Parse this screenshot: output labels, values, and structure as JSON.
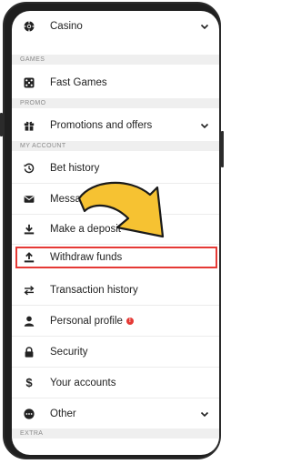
{
  "menu": {
    "casino": "Casino",
    "sections": {
      "games": "GAMES",
      "promo": "PROMO",
      "my_account": "MY ACCOUNT",
      "extra": "EXTRA"
    },
    "fast_games": "Fast Games",
    "promotions": "Promotions and offers",
    "bet_history": "Bet history",
    "messages": "Messages",
    "make_deposit": "Make a deposit",
    "withdraw": "Withdraw funds",
    "transaction_history": "Transaction history",
    "personal_profile": "Personal profile",
    "profile_badge": "!",
    "security": "Security",
    "your_accounts": "Your accounts",
    "other": "Other"
  },
  "colors": {
    "highlight": "#e53935",
    "arrow_fill": "#f6c232",
    "arrow_stroke": "#1a1a1a"
  }
}
